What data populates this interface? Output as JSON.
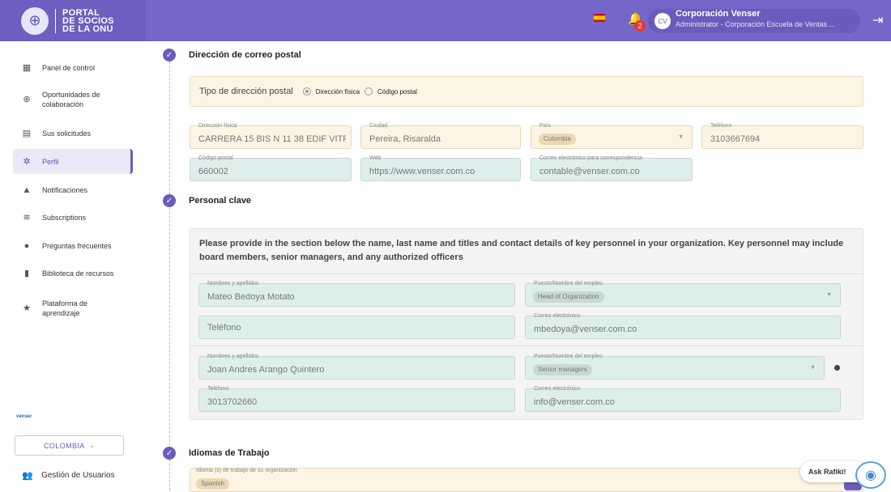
{
  "header": {
    "logo_line1": "PORTAL",
    "logo_line2": "DE SOCIOS",
    "logo_line3": "DE LA ONU",
    "notification_count": "2",
    "avatar_initials": "CV",
    "user_name": "Corporación Venser",
    "user_role": "Administrator - Corporación Escuela de Ventas ..."
  },
  "sidebar": {
    "items": [
      {
        "label": "Panel de control",
        "icon": "dashboard-icon"
      },
      {
        "label": "Oportunidades de colaboración",
        "icon": "globe-icon"
      },
      {
        "label": "Sus solicitudes",
        "icon": "clipboard-icon"
      },
      {
        "label": "Perfil",
        "icon": "gear-icon"
      },
      {
        "label": "Notificaciones",
        "icon": "bell-icon"
      },
      {
        "label": "Subscriptions",
        "icon": "rss-icon"
      },
      {
        "label": "Preguntas frecuentes",
        "icon": "help-icon"
      },
      {
        "label": "Biblioteca de recursos",
        "icon": "book-icon"
      },
      {
        "label": "Plataforma de aprendizaje",
        "icon": "star-icon"
      }
    ],
    "org_logo_text": "venser",
    "country_button": "COLOMBIA",
    "gestion_label": "Gestión de Usuarios"
  },
  "postal": {
    "title": "Dirección de correo postal",
    "tipo_label": "Tipo de dirección postal",
    "option_physical": "Dirección física",
    "option_postal": "Código postal",
    "fields": {
      "direccion_label": "Dirección física",
      "direccion_value": "CARRERA 15 BIS N 11 38 EDIF VITR/",
      "ciudad_label": "Ciudad",
      "ciudad_value": "Pereira, Risaralda",
      "pais_label": "País",
      "pais_value": "Colombia",
      "telefono_label": "Teléfono",
      "telefono_value": "3103667694",
      "codigo_label": "Código postal",
      "codigo_value": "660002",
      "web_label": "Web",
      "web_value": "https://www.venser.com.co",
      "correo_label": "Correo electrónico para correspondencia",
      "correo_value": "contable@venser.com.co"
    }
  },
  "key_personnel": {
    "title": "Personal clave",
    "description": "Please provide in the section below the name, last name and titles and contact details of key personnel in your organization. Key personnel may include board members, senior managers, and any authorized officers",
    "person1": {
      "name_label": "Nombres y apellidos",
      "name_value": "Mateo Bedoya Motato",
      "job_label": "Puesto/Nombre del empleo",
      "job_value": "Head of Organization",
      "phone_placeholder": "Teléfono",
      "email_label": "Correo electrónico",
      "email_value": "mbedoya@venser.com.co"
    },
    "person2": {
      "name_label": "Nombres y apellidos",
      "name_value": "Joan Andres Arango Quintero",
      "job_label": "Puesto/Nombre del empleo",
      "job_value": "Senior managers",
      "phone_label": "Teléfono",
      "phone_value": "3013702660",
      "email_label": "Correo electrónico",
      "email_value": "info@venser.com.co"
    }
  },
  "languages": {
    "title": "Idiomas de Trabajo",
    "field_label": "Idioma (s) de trabajo de su organización",
    "value": "Spanish"
  },
  "assistant": {
    "label": "Ask Rafiki!"
  }
}
